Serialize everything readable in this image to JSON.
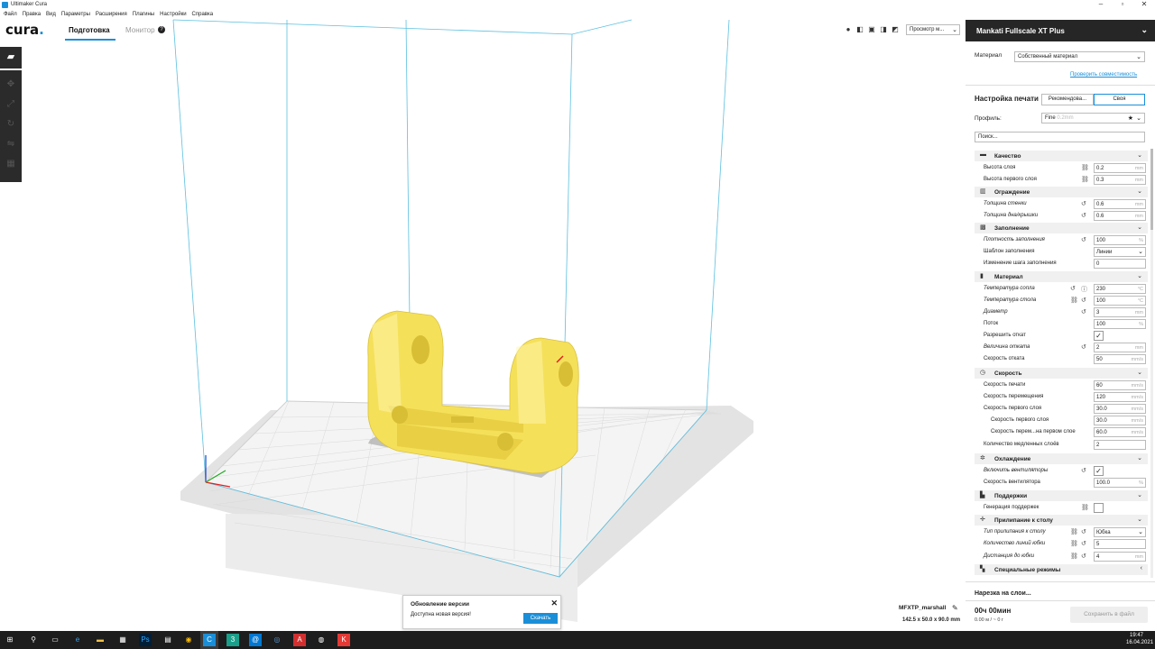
{
  "window": {
    "title": "Ultimaker Cura",
    "minimize": "–",
    "maximize": "▫",
    "close": "✕"
  },
  "menu": [
    "Файл",
    "Правка",
    "Вид",
    "Параметры",
    "Расширения",
    "Плагины",
    "Настройки",
    "Справка"
  ],
  "header": {
    "logo": "cura",
    "logo_dot": ".",
    "tab_prepare": "Подготовка",
    "tab_monitor": "Монитор",
    "help_glyph": "?"
  },
  "view": {
    "camera_select": "Просмотр м..."
  },
  "icons": {
    "open": "folder-open-icon",
    "move": "move-icon",
    "scale": "scale-icon",
    "rotate": "rotate-icon",
    "mirror": "mirror-icon",
    "per_model": "per-model-settings-icon",
    "support_blocker": "support-blocker-icon"
  },
  "panel": {
    "printer_name": "Mankati Fullscale XT Plus",
    "material_label": "Материал",
    "material_value": "Собственный материал",
    "compat_link": "Проверить совместимость",
    "print_setup_title": "Настройка печати",
    "mode_recommended": "Рекомендова...",
    "mode_custom": "Своя",
    "profile_label": "Профиль:",
    "profile_value": "Fine",
    "profile_sub": "0.2mm",
    "search_placeholder": "Поиск...",
    "slice_label": "Нарезка на слои...",
    "time": "00ч 00мин",
    "material_amount": "0.00 м / ~ 0 г",
    "save_button": "Сохранить в файл"
  },
  "settings": {
    "quality": {
      "label": "Качество",
      "rows": [
        {
          "label": "Высота слоя",
          "value": "0.2",
          "unit": "mm"
        },
        {
          "label": "Высота первого слоя",
          "value": "0.3",
          "unit": "mm"
        }
      ]
    },
    "shell": {
      "label": "Ограждение",
      "rows": [
        {
          "label": "Толщина стенки",
          "value": "0.6",
          "unit": "mm"
        },
        {
          "label": "Толщина дна/крышки",
          "value": "0.6",
          "unit": "mm"
        }
      ]
    },
    "infill": {
      "label": "Заполнение",
      "rows": [
        {
          "label": "Плотность заполнения",
          "value": "100",
          "unit": "%"
        },
        {
          "label": "Шаблон заполнения",
          "value": "Линии"
        },
        {
          "label": "Изменение шага заполнения",
          "value": "0"
        }
      ]
    },
    "material": {
      "label": "Материал",
      "rows": [
        {
          "label": "Температура сопла",
          "value": "230",
          "unit": "°C"
        },
        {
          "label": "Температура стола",
          "value": "100",
          "unit": "°C"
        },
        {
          "label": "Диаметр",
          "value": "3",
          "unit": "mm"
        },
        {
          "label": "Поток",
          "value": "100",
          "unit": "%"
        },
        {
          "label": "Разрешить откат",
          "checked": "✓"
        },
        {
          "label": "Величина отката",
          "value": "2",
          "unit": "mm"
        },
        {
          "label": "Скорость отката",
          "value": "50",
          "unit": "mm/s"
        }
      ]
    },
    "speed": {
      "label": "Скорость",
      "rows": [
        {
          "label": "Скорость печати",
          "value": "60",
          "unit": "mm/s"
        },
        {
          "label": "Скорость перемещения",
          "value": "120",
          "unit": "mm/s"
        },
        {
          "label": "Скорость первого слоя",
          "value": "30.0",
          "unit": "mm/s"
        },
        {
          "label": "Скорость первого слоя",
          "value": "30.0",
          "unit": "mm/s"
        },
        {
          "label": "Скорость перем...на первом слое",
          "value": "60.0",
          "unit": "mm/s"
        },
        {
          "label": "Количество медленных слоёв",
          "value": "2"
        }
      ]
    },
    "cooling": {
      "label": "Охлаждение",
      "rows": [
        {
          "label": "Включить вентиляторы",
          "checked": "✓"
        },
        {
          "label": "Скорость вентилятора",
          "value": "100.0",
          "unit": "%"
        }
      ]
    },
    "support": {
      "label": "Поддержки",
      "rows": [
        {
          "label": "Генерация поддержек",
          "checked": ""
        }
      ]
    },
    "adhesion": {
      "label": "Прилипание к столу",
      "rows": [
        {
          "label": "Тип прилипания к столу",
          "value": "Юбка"
        },
        {
          "label": "Количество линий юбки",
          "value": "5"
        },
        {
          "label": "Дистанция до юбки",
          "value": "4",
          "unit": "mm"
        }
      ]
    },
    "special": {
      "label": "Специальные режимы"
    }
  },
  "job": {
    "name": "MFXTP_marshall",
    "dims": "142.5 x 50.0 x 90.0 mm"
  },
  "toast": {
    "title": "Обновление версии",
    "body": "Доступна новая версия!",
    "button": "Скачать",
    "close": "✕"
  },
  "taskbar": {
    "time": "19:47",
    "date": "16.04.2021"
  },
  "colors": {
    "accent": "#1a8fd8",
    "model": "#f5e05a",
    "panel_header": "#262626"
  }
}
